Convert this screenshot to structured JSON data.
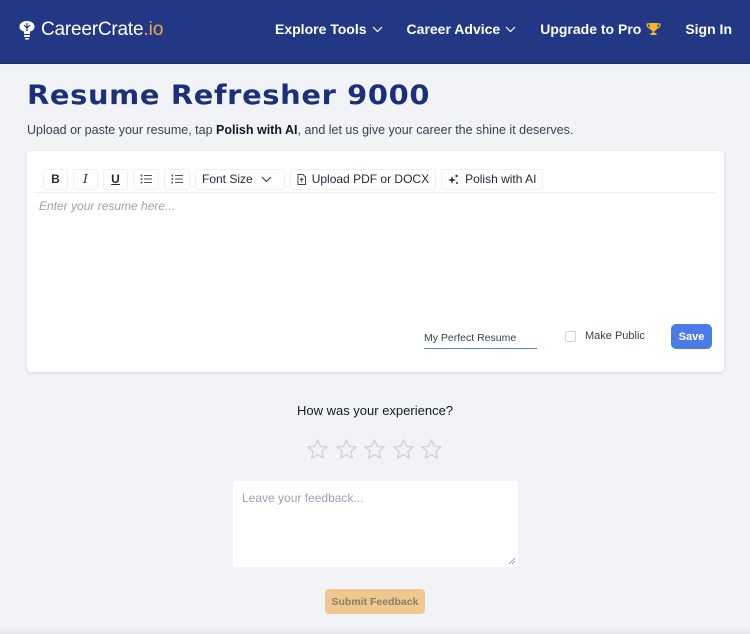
{
  "brand": {
    "name": "CareerCrate",
    "tld": ".io",
    "icon": "brain-lightbulb-icon",
    "accent": "#f0a446"
  },
  "nav": {
    "items": [
      {
        "label": "Explore Tools",
        "icon": "chevron-down-icon"
      },
      {
        "label": "Career Advice",
        "icon": "chevron-down-icon"
      },
      {
        "label": "Upgrade to Pro",
        "icon": "trophy-icon"
      },
      {
        "label": "Sign In"
      }
    ],
    "background": "#233884"
  },
  "page": {
    "title": "Resume Refresher 9000",
    "subtitle_pre": "Upload or paste your resume, tap ",
    "subtitle_bold": "Polish with AI",
    "subtitle_post": ", and let us give your career the shine it deserves."
  },
  "editor": {
    "toolbar": {
      "bold": "B",
      "italic": "I",
      "underline": "U",
      "font_size": "Font Size",
      "upload": "Upload PDF or DOCX",
      "polish": "Polish with AI"
    },
    "placeholder": "Enter your resume here...",
    "doc_name": "My Perfect Resume",
    "make_public_label": "Make Public",
    "make_public_checked": false,
    "save_label": "Save",
    "save_color": "#4b7ce6"
  },
  "feedback": {
    "question": "How was your experience?",
    "rating": 0,
    "max_rating": 5,
    "placeholder": "Leave your feedback...",
    "submit_label": "Submit Feedback",
    "submit_color": "#efc88f"
  }
}
